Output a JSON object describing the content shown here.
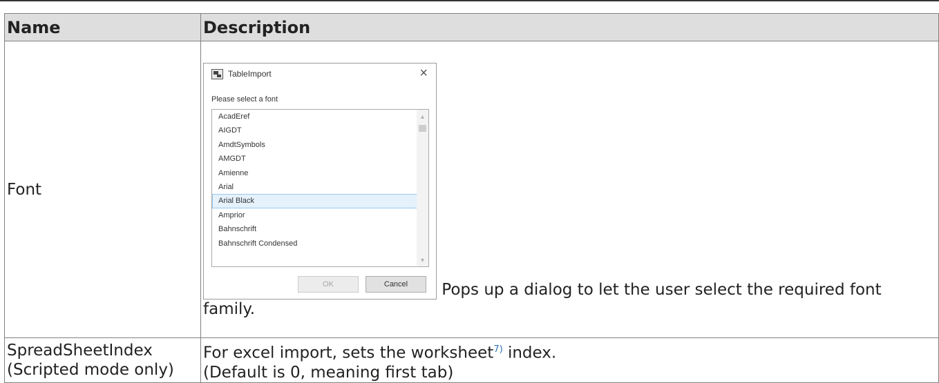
{
  "table": {
    "headers": {
      "name": "Name",
      "description": "Description"
    },
    "rows": [
      {
        "name": "Font",
        "dialog": {
          "title": "TableImport",
          "close_symbol": "×",
          "prompt": "Please select a font",
          "fonts": [
            "AcadEref",
            "AIGDT",
            "AmdtSymbols",
            "AMGDT",
            "Amienne",
            "Arial",
            "Arial Black",
            "Amprior",
            "Bahnschrift",
            "Bahnschrift Condensed"
          ],
          "selected_font": "Arial Black",
          "ok_label": "OK",
          "cancel_label": "Cancel"
        },
        "description_after": " Pops up a dialog to let the user select the required font family."
      },
      {
        "name_line1": "SpreadSheetIndex",
        "name_line2": "(Scripted mode only)",
        "description_line1_before": "For excel import, sets the worksheet",
        "footnote": "7)",
        "description_line1_after": " index.",
        "description_line2": "(Default is 0, meaning first tab)"
      }
    ]
  },
  "icons": {
    "app_icon": "tableimport-app-icon",
    "close": "close-icon",
    "scroll_up": "scroll-up-icon",
    "scroll_down": "scroll-down-icon"
  }
}
